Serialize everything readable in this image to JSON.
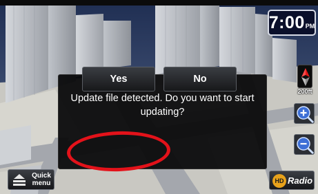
{
  "status": {
    "clock_time": "7:00",
    "clock_ampm": "PM"
  },
  "map": {
    "scale_label": "200ft",
    "compass_icon": "compass-north-icon",
    "zoom_in_icon": "zoom-in-icon",
    "zoom_out_icon": "zoom-out-icon"
  },
  "dialog": {
    "message": "Update file detected. Do you want to start updating?",
    "yes_label": "Yes",
    "no_label": "No",
    "highlight_color": "#e3121a"
  },
  "bottom_bar": {
    "quick_menu_line1": "Quick",
    "quick_menu_line2": "menu",
    "quick_menu_icon": "quick-menu-icon",
    "hd_logo_text": "HD",
    "radio_label": "Radio"
  },
  "colors": {
    "dialog_bg": "#060608",
    "clock_bg": "#0a0f2a",
    "road": "#9a9da3",
    "buildings": "#b8bcc3"
  }
}
